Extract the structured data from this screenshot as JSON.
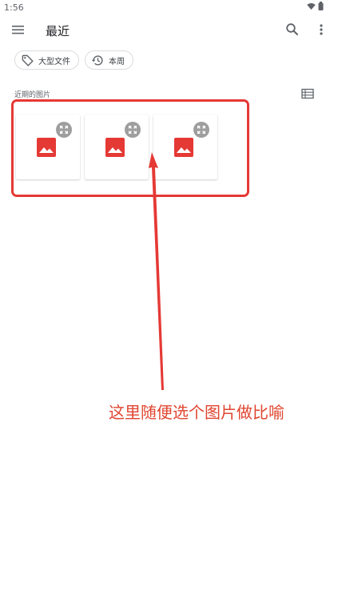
{
  "status_bar": {
    "time": "1:56"
  },
  "app_bar": {
    "title": "最近"
  },
  "chips": [
    {
      "label": "大型文件",
      "icon": "tag-icon"
    },
    {
      "label": "本周",
      "icon": "history-icon"
    }
  ],
  "section": {
    "label": "近期的图片"
  },
  "thumbnails": [
    {
      "icon": "image-icon",
      "overlay_icon": "expand-icon"
    },
    {
      "icon": "image-icon",
      "overlay_icon": "expand-icon"
    },
    {
      "icon": "image-icon",
      "overlay_icon": "expand-icon"
    }
  ],
  "annotation": {
    "text": "这里随便选个图片做比喻"
  },
  "colors": {
    "accent_red": "#e53935",
    "image_icon_red": "#e53935",
    "overlay_grey": "#9e9e9e",
    "chip_border": "#dadce0"
  }
}
